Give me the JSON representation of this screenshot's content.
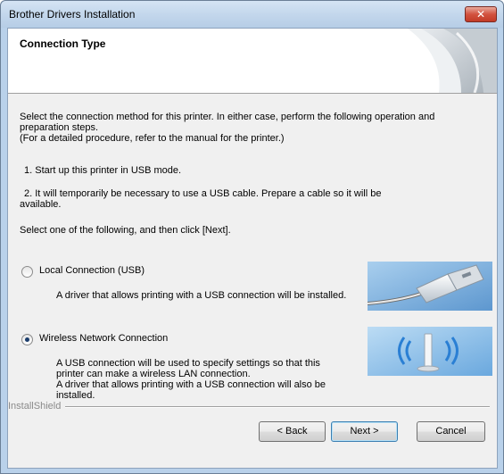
{
  "window": {
    "title": "Brother Drivers Installation",
    "close_glyph": "✕"
  },
  "header": {
    "title": "Connection Type"
  },
  "intro": {
    "line1": "Select the connection method for this printer. In either case, perform the following operation and",
    "line2": "preparation steps.",
    "line3": "(For a detailed procedure, refer to the manual for the printer.)"
  },
  "steps": {
    "step1": "1. Start up this printer in USB mode.",
    "step2_line1": "2. It will temporarily be necessary to use a USB cable. Prepare a cable so it will be",
    "step2_line2": "available."
  },
  "instruction": "Select one of the following, and then click [Next].",
  "options": [
    {
      "label": "Local Connection (USB)",
      "selected": false,
      "desc_lines": [
        "A driver that allows printing with a USB connection will be installed."
      ],
      "image_icon": "usb-cable-icon"
    },
    {
      "label": "Wireless Network Connection",
      "selected": true,
      "desc_lines": [
        "A USB connection will be used to specify settings so that this",
        "printer can make a wireless LAN connection.",
        "A driver that allows printing with a USB connection will also be",
        "installed."
      ],
      "image_icon": "wireless-signal-icon"
    }
  ],
  "footer": {
    "brand": "InstallShield",
    "back_label": "< Back",
    "next_label": "Next >",
    "cancel_label": "Cancel"
  },
  "colors": {
    "titlebar": "#c3d7ec",
    "close_button": "#c23a26",
    "dialog_bg": "#f0f0f0",
    "image_blue": "#6fa9dd",
    "default_button_border": "#3c7fb1"
  }
}
